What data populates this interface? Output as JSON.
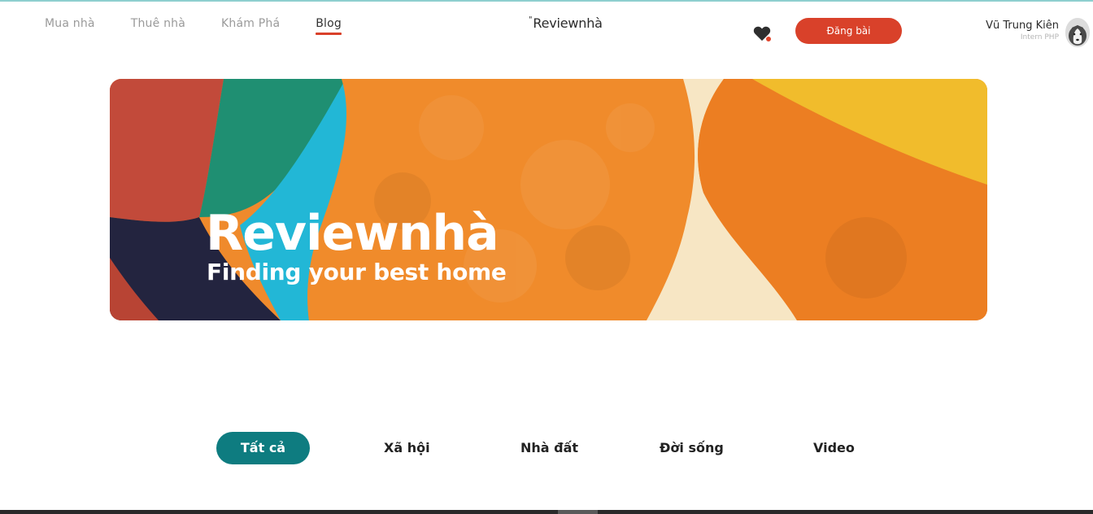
{
  "header": {
    "nav": [
      {
        "label": "Mua nhà",
        "active": false
      },
      {
        "label": "Thuê nhà",
        "active": false
      },
      {
        "label": "Khám Phá",
        "active": false
      },
      {
        "label": "Blog",
        "active": true
      }
    ],
    "logo": "Reviewnhà",
    "post_button": "Đăng bài",
    "user": {
      "name": "Vũ Trung Kiên",
      "role": "Intern PHP"
    }
  },
  "hero": {
    "title": "Reviewnhà",
    "subtitle": "Finding your best home"
  },
  "categories": {
    "tabs": [
      "Tất cả",
      "Xã hội",
      "Nhà đất",
      "Đời sống",
      "Video"
    ],
    "active": "Tất cả"
  },
  "colors": {
    "accent": "#d9412a",
    "teal": "#0e7c80"
  }
}
